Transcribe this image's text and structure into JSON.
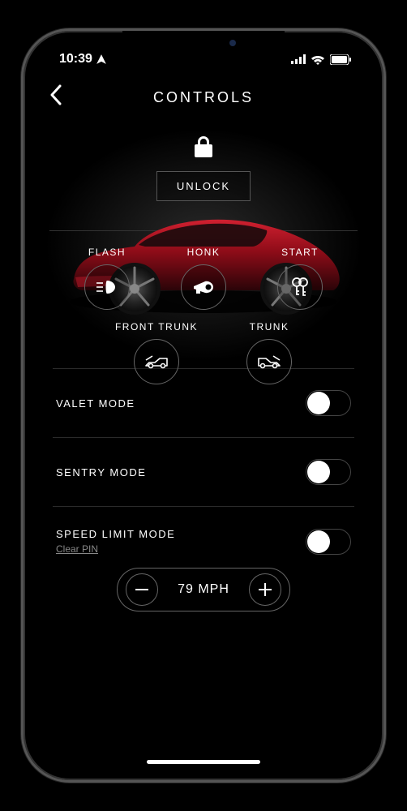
{
  "status": {
    "time": "10:39"
  },
  "header": {
    "title": "CONTROLS"
  },
  "lock": {
    "unlock_label": "UNLOCK"
  },
  "actions": {
    "flash": "FLASH",
    "honk": "HONK",
    "start": "START",
    "front_trunk": "FRONT TRUNK",
    "trunk": "TRUNK"
  },
  "toggles": {
    "valet": {
      "label": "VALET MODE",
      "on": false
    },
    "sentry": {
      "label": "SENTRY MODE",
      "on": false
    },
    "speed_limit": {
      "label": "SPEED LIMIT MODE",
      "on": false,
      "clear_pin": "Clear PIN"
    }
  },
  "speed": {
    "value": "79 MPH"
  }
}
